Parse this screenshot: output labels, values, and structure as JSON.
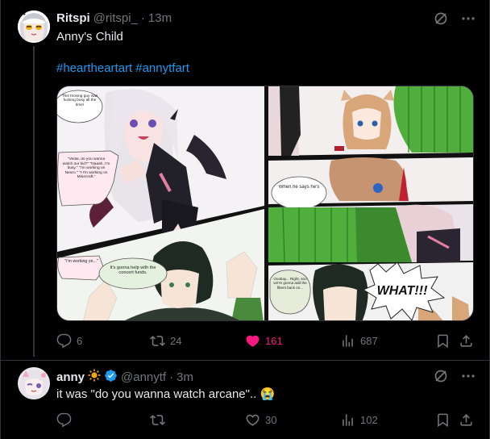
{
  "tweets": [
    {
      "author_name": "Ritspi",
      "handle": "@ritspi_",
      "time": "13m",
      "text": "Anny's Child",
      "hashtags": [
        "#heartheartart",
        "#annytfart"
      ],
      "stats": {
        "replies": "6",
        "reposts": "24",
        "likes": "161",
        "views": "687"
      },
      "liked": true,
      "comic_text": {
        "p1_bubble": "This fricking guy was fucking busy all the time!",
        "p1_dialog": "\"Vedal, do you wanna watch our kid?\" \"Naaah, I'm busy.\" \"I'm working on Neuro.\" \"I-I'm working on Minecraft.\"",
        "p3_bubble_left": "\"I'm working on...\"",
        "p3_bubble_right": "It's gonna help with the concert funds.",
        "p5_bubble": "When he says he's",
        "p7_bubble": "Oookay... Right, soo we're gonna add the filters back on...",
        "p7_shout": "WHAT!!!"
      }
    },
    {
      "author_name": "anny",
      "handle": "@annytf",
      "time": "3m",
      "text": "it was \"do you wanna watch arcane\"..",
      "emoji": "😭",
      "stats": {
        "replies": "",
        "reposts": "",
        "likes": "30",
        "views": "102"
      },
      "liked": false
    }
  ],
  "colors": {
    "accent": "#1d9bf0",
    "like": "#f91880",
    "muted": "#71767b",
    "verified": "#1d9bf0"
  },
  "icons": [
    "grok-icon",
    "more-icon",
    "reply-icon",
    "repost-icon",
    "like-icon",
    "views-icon",
    "bookmark-icon",
    "share-icon",
    "sun-icon",
    "verified-icon"
  ]
}
